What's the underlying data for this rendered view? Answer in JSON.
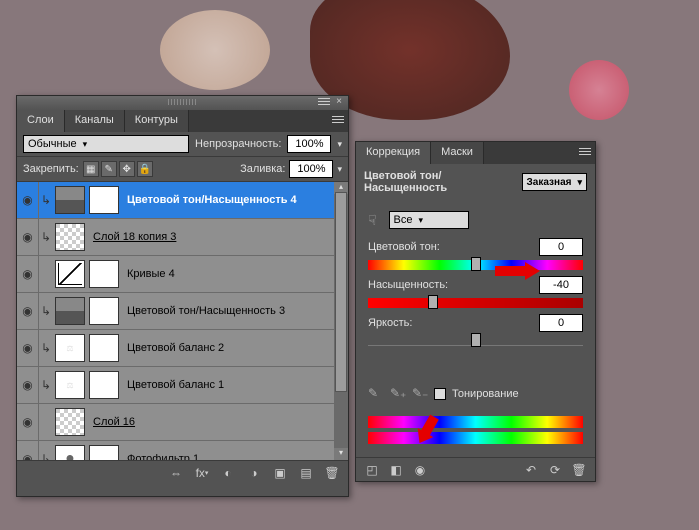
{
  "layers_panel": {
    "tabs": [
      "Слои",
      "Каналы",
      "Контуры"
    ],
    "active_tab": 0,
    "blend_mode": "Обычные",
    "opacity_label": "Непрозрачность:",
    "opacity_value": "100%",
    "lock_label": "Закрепить:",
    "fill_label": "Заливка:",
    "fill_value": "100%",
    "layers": [
      {
        "name": "Цветовой тон/Насыщенность 4",
        "type": "hs",
        "selected": true,
        "clipped": true
      },
      {
        "name": "Слой 18 копия 3",
        "type": "checker",
        "selected": false,
        "clipped": true,
        "underline": true
      },
      {
        "name": "Кривые 4",
        "type": "curves",
        "selected": false,
        "clipped": false
      },
      {
        "name": "Цветовой тон/Насыщенность 3",
        "type": "hs",
        "selected": false,
        "clipped": true
      },
      {
        "name": "Цветовой баланс 2",
        "type": "balance",
        "selected": false,
        "clipped": true
      },
      {
        "name": "Цветовой баланс 1",
        "type": "balance",
        "selected": false,
        "clipped": true
      },
      {
        "name": "Слой 16",
        "type": "checker",
        "selected": false,
        "clipped": false,
        "underline": true
      },
      {
        "name": "Фотофильтр 1",
        "type": "photofilter",
        "selected": false,
        "clipped": true
      }
    ]
  },
  "adj_panel": {
    "tabs": [
      "Коррекция",
      "Маски"
    ],
    "active_tab": 0,
    "title": "Цветовой тон/Насыщенность",
    "preset": "Заказная",
    "channel": "Все",
    "hue_label": "Цветовой тон:",
    "hue_value": "0",
    "sat_label": "Насыщенность:",
    "sat_value": "-40",
    "light_label": "Яркость:",
    "light_value": "0",
    "colorize_label": "Тонирование"
  }
}
